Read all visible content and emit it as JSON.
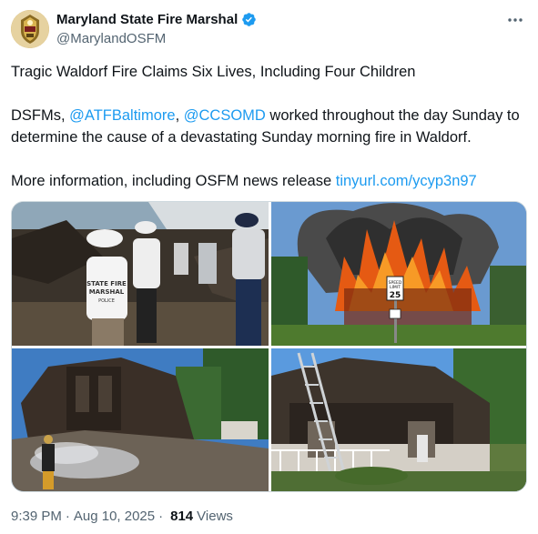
{
  "author": {
    "name": "Maryland State Fire Marshal",
    "handle": "@MarylandOSFM",
    "verified": true,
    "avatar_icon": "fire-marshal-badge-avatar"
  },
  "tweet": {
    "headline": "Tragic Waldorf Fire Claims Six Lives, Including Four Children",
    "p2_prefix": "DSFMs, ",
    "mention1": "@ATFBaltimore",
    "p2_sep": ", ",
    "mention2": "@CCSOMD",
    "p2_suffix": " worked throughout the day Sunday to determine the cause of a devastating Sunday morning fire in Waldorf.",
    "p3_prefix": "More information, including OSFM news release ",
    "link": "tinyurl.com/ycyp3n97"
  },
  "media": {
    "photos": [
      {
        "name": "investigators-at-fire-scene",
        "shirt_text": "STATE FIRE MARSHAL POLICE"
      },
      {
        "name": "house-fully-engulfed-in-flames",
        "sign_text": "SPEED LIMIT 25"
      },
      {
        "name": "burned-house-smoldering-debris"
      },
      {
        "name": "burned-house-with-ladder"
      }
    ]
  },
  "meta": {
    "time": "9:39 PM",
    "separator": "·",
    "date": "Aug 10, 2025",
    "views_count": "814",
    "views_label": "Views"
  },
  "colors": {
    "link": "#1d9bf0",
    "verified": "#1d9bf0",
    "secondary_text": "#536471",
    "primary_text": "#0f1419"
  }
}
